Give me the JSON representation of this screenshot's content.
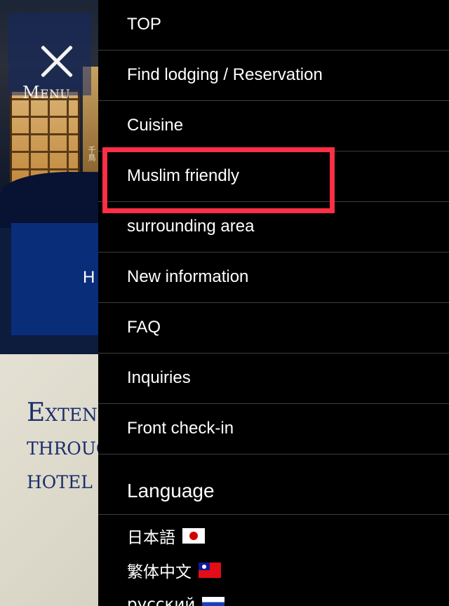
{
  "background": {
    "menu_toggle_label": "Menu",
    "hero_card_text": "H",
    "hero_sign_text": "千鳥",
    "content_heading": "Extend through hotel"
  },
  "drawer": {
    "nav_items": [
      {
        "label": "TOP"
      },
      {
        "label": "Find lodging / Reservation"
      },
      {
        "label": "Cuisine"
      },
      {
        "label": "Muslim friendly"
      },
      {
        "label": "surrounding area"
      },
      {
        "label": "New information"
      },
      {
        "label": "FAQ"
      },
      {
        "label": "Inquiries"
      },
      {
        "label": "Front check-in"
      }
    ],
    "language_header": "Language",
    "languages": [
      {
        "label": "日本語",
        "flag": "japan-flag-icon"
      },
      {
        "label": "繁体中文",
        "flag": "taiwan-flag-icon"
      },
      {
        "label": "русский",
        "flag": "russia-flag-icon"
      }
    ]
  },
  "colors": {
    "drawer_bg": "#000000",
    "divider": "#3d3d3d",
    "highlight": "#ff2f45",
    "brand_navy": "#0a2d7a"
  }
}
